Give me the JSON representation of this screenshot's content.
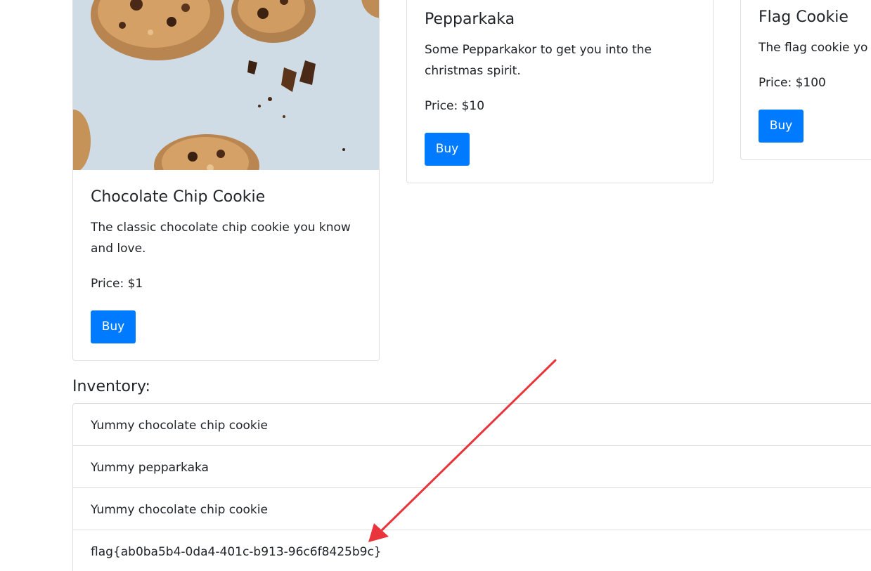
{
  "products": [
    {
      "title": "Chocolate Chip Cookie",
      "description": "The classic chocolate chip cookie you know and love.",
      "price": "Price: $1",
      "buy_label": "Buy"
    },
    {
      "title": "Pepparkaka",
      "description": "Some Pepparkakor to get you into the christmas spirit.",
      "price": "Price: $10",
      "buy_label": "Buy"
    },
    {
      "title": "Flag Cookie",
      "description": "The flag cookie yo",
      "price": "Price: $100",
      "buy_label": "Buy"
    }
  ],
  "inventory": {
    "heading": "Inventory:",
    "items": [
      "Yummy chocolate chip cookie",
      "Yummy pepparkaka",
      "Yummy chocolate chip cookie",
      "flag{ab0ba5b4-0da4-401c-b913-96c6f8425b9c}"
    ]
  },
  "colors": {
    "button": "#007bff",
    "annotation_arrow": "#e8343a",
    "image_background": "#cdd9e2"
  }
}
